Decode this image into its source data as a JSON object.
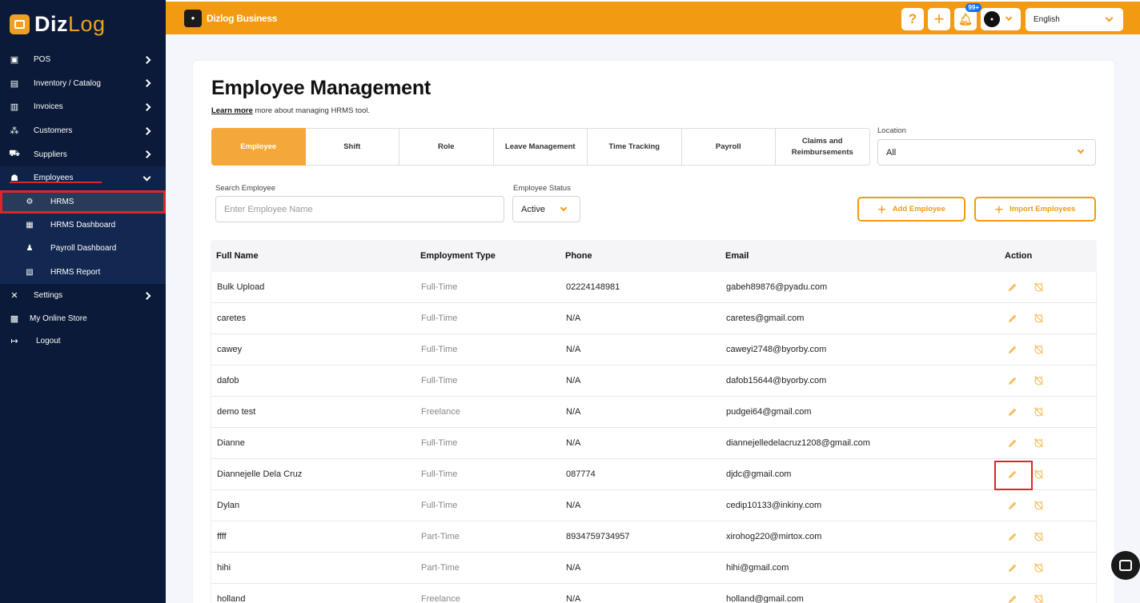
{
  "sidebar": {
    "brand_part1": "Diz",
    "brand_part2": "Log",
    "items": [
      {
        "label": "POS",
        "icon": "pos-icon"
      },
      {
        "label": "Inventory / Catalog",
        "icon": "inventory-icon"
      },
      {
        "label": "Invoices",
        "icon": "invoice-icon"
      },
      {
        "label": "Customers",
        "icon": "customers-icon"
      },
      {
        "label": "Suppliers",
        "icon": "suppliers-icon"
      },
      {
        "label": "Employees",
        "icon": "employees-icon"
      }
    ],
    "sub_items": [
      {
        "label": "HRMS",
        "icon": "hrms-icon"
      },
      {
        "label": "HRMS Dashboard",
        "icon": "dashboard-icon"
      },
      {
        "label": "Payroll Dashboard",
        "icon": "payroll-icon"
      },
      {
        "label": "HRMS Report",
        "icon": "report-icon"
      }
    ],
    "bottom_items": [
      {
        "label": "Settings",
        "icon": "settings-icon"
      },
      {
        "label": "My Online Store",
        "icon": "store-icon"
      },
      {
        "label": "Logout",
        "icon": "logout-icon"
      }
    ]
  },
  "topbar": {
    "business_name": "Dizlog Business",
    "help": "?",
    "add": "+",
    "notification_badge": "99+",
    "language": "English"
  },
  "page": {
    "title": "Employee Management",
    "learn_more": "Learn more",
    "learn_rest": " more about managing HRMS tool."
  },
  "tabs": [
    "Employee",
    "Shift",
    "Role",
    "Leave Management",
    "Time Tracking",
    "Payroll",
    "Claims and Reimbursements"
  ],
  "location": {
    "label": "Location",
    "value": "All"
  },
  "search": {
    "label": "Search Employee",
    "placeholder": "Enter Employee Name"
  },
  "status": {
    "label": "Employee Status",
    "value": "Active"
  },
  "buttons": {
    "add_employee": "Add Employee",
    "import_employees": "Import Employees"
  },
  "table": {
    "headers": [
      "Full Name",
      "Employment Type",
      "Phone",
      "Email",
      "Action"
    ],
    "rows": [
      {
        "name": "Bulk Upload",
        "type": "Full-Time",
        "phone": "02224148981",
        "email": "gabeh89876@pyadu.com"
      },
      {
        "name": "caretes",
        "type": "Full-Time",
        "phone": "N/A",
        "email": "caretes@gmail.com"
      },
      {
        "name": "cawey",
        "type": "Full-Time",
        "phone": "N/A",
        "email": "caweyi2748@byorby.com"
      },
      {
        "name": "dafob",
        "type": "Full-Time",
        "phone": "N/A",
        "email": "dafob15644@byorby.com"
      },
      {
        "name": "demo test",
        "type": "Freelance",
        "phone": "N/A",
        "email": "pudgei64@gmail.com"
      },
      {
        "name": "Dianne",
        "type": "Full-Time",
        "phone": "N/A",
        "email": "diannejelledelacruz1208@gmail.com"
      },
      {
        "name": "Diannejelle Dela Cruz",
        "type": "Full-Time",
        "phone": "087774",
        "email": "djdc@gmail.com"
      },
      {
        "name": "Dylan",
        "type": "Full-Time",
        "phone": "N/A",
        "email": "cedip10133@inkiny.com"
      },
      {
        "name": "ffff",
        "type": "Part-Time",
        "phone": "8934759734957",
        "email": "xirohog220@mirtox.com"
      },
      {
        "name": "hihi",
        "type": "Part-Time",
        "phone": "N/A",
        "email": "hihi@gmail.com"
      },
      {
        "name": "holland",
        "type": "Freelance",
        "phone": "N/A",
        "email": "holland@gmail.com"
      }
    ]
  },
  "colors": {
    "accent": "#f29a12",
    "sidebar": "#0b1a38",
    "highlight": "#e0242d"
  }
}
